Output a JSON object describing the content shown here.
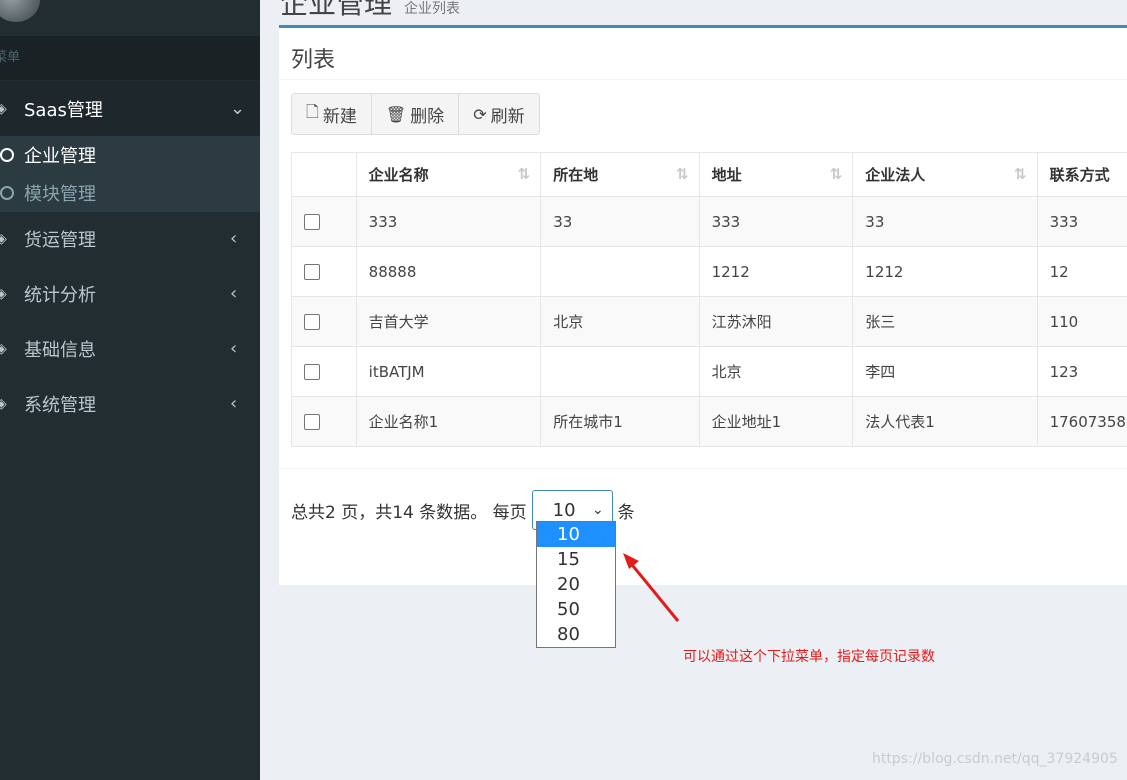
{
  "sidebar": {
    "menu_header": "菜单",
    "sections": [
      {
        "label": "Saas管理",
        "expanded": true,
        "children": [
          {
            "label": "企业管理",
            "active": true
          },
          {
            "label": "模块管理",
            "active": false
          }
        ]
      },
      {
        "label": "货运管理",
        "expanded": false
      },
      {
        "label": "统计分析",
        "expanded": false
      },
      {
        "label": "基础信息",
        "expanded": false
      },
      {
        "label": "系统管理",
        "expanded": false
      }
    ]
  },
  "page": {
    "title": "企业管理",
    "subtitle": "企业列表"
  },
  "box": {
    "title": "列表"
  },
  "toolbar": {
    "new_label": "新建",
    "delete_label": "删除",
    "refresh_label": "刷新"
  },
  "table": {
    "columns": [
      "企业名称",
      "所在地",
      "地址",
      "企业法人",
      "联系方式"
    ],
    "rows": [
      [
        "333",
        "33",
        "333",
        "33",
        "333"
      ],
      [
        "88888",
        "",
        "1212",
        "1212",
        "12"
      ],
      [
        "吉首大学",
        "北京",
        "江苏沐阳",
        "张三",
        "110"
      ],
      [
        "itBATJM",
        "",
        "北京",
        "李四",
        "123"
      ],
      [
        "企业名称1",
        "所在城市1",
        "企业地址1",
        "法人代表1",
        "17607358"
      ]
    ]
  },
  "pager": {
    "summary": "总共2 页，共14 条数据。 每页",
    "page_size": "10",
    "unit": "条",
    "options": [
      "10",
      "15",
      "20",
      "50",
      "80"
    ]
  },
  "annotation": "可以通过这个下拉菜单，指定每页记录数",
  "watermark": "https://blog.csdn.net/qq_37924905",
  "colors": {
    "sidebar_bg": "#222d32",
    "accent": "#3c8dbc",
    "annotation": "#e31b1b",
    "dropdown_selected": "#1e90ff"
  }
}
